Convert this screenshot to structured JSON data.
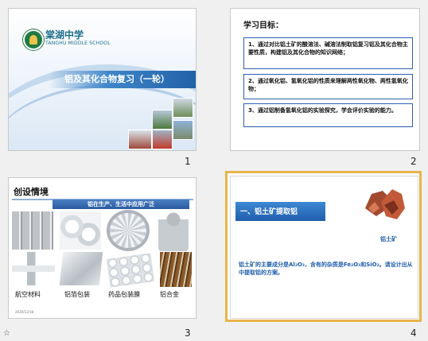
{
  "slides": [
    {
      "number": "1",
      "school_cn": "棠湖中学",
      "school_en": "TANGHU MIDDLE SCHOOL",
      "title": "铝及其化合物复习（一轮）"
    },
    {
      "number": "2",
      "heading": "学习目标：",
      "goals": [
        "1、通过对比铝土矿的酸溶法、碱溶法制取铝复习铝及其化合物主要性质，构建铝及其化合物的知识网络；",
        "2、通过氧化铝、氢氧化铝的性质来理解两性氧化物、两性氢氧化物；",
        "3、通过铝制备氢氧化铝的实验探究，学会评价实验的能力。"
      ]
    },
    {
      "number": "3",
      "heading": "创设情境",
      "banner": "铝在生产、生活中应用广泛",
      "captions": [
        "航空材料",
        "铝箔包装",
        "药品包装膜",
        "铝合金"
      ],
      "date": "2020/12/18"
    },
    {
      "number": "4",
      "title": "一、铝土矿提取铝",
      "rock_label": "铝土矿",
      "body": "铝土矿的主要成分是Al₂O₃，含有的杂质是Fe₂O₃和SiO₂。请设计出从中提取铝的方案。"
    }
  ],
  "status": {
    "star": "☆"
  }
}
